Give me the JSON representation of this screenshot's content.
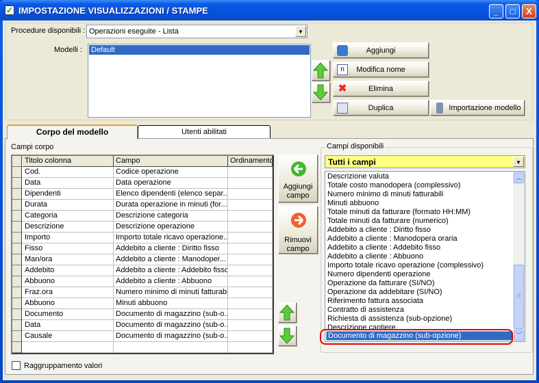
{
  "window": {
    "title": "IMPOSTAZIONE VISUALIZZAZIONI / STAMPE",
    "minimize": "_",
    "maximize": "□",
    "close": "X"
  },
  "top": {
    "procedure_label": "Procedure disponibili :",
    "procedure_value": "Operazioni eseguite - Lista",
    "modelli_label": "Modelli :",
    "modelli": [
      "Default"
    ],
    "buttons": {
      "aggiungi": "Aggiungi",
      "modifica": "Modifica nome",
      "elimina": "Elimina",
      "duplica": "Duplica",
      "importazione": "Importazione modello"
    }
  },
  "tabs": [
    {
      "label": "Corpo del modello",
      "active": true
    },
    {
      "label": "Utenti abilitati",
      "active": false
    }
  ],
  "corpo": {
    "label": "Campi corpo",
    "columns": [
      "Titolo colonna",
      "Campo",
      "Ordinamento"
    ],
    "rows": [
      [
        "Cod.",
        "Codice operazione",
        ""
      ],
      [
        "Data",
        "Data operazione",
        ""
      ],
      [
        "Dipendenti",
        "Elenco dipendenti (elenco separ...",
        ""
      ],
      [
        "Durata",
        "Durata operazione in minuti (for...",
        ""
      ],
      [
        "Categoria",
        "Descrizione categoria",
        ""
      ],
      [
        "Descrizione",
        "Descrizione operazione",
        ""
      ],
      [
        "Importo",
        "Importo totale ricavo operazione...",
        ""
      ],
      [
        "Fisso",
        "Addebito a cliente : Diritto fisso",
        ""
      ],
      [
        "Man/ora",
        "Addebito a cliente : Manodoper...",
        ""
      ],
      [
        "Addebito",
        "Addebito a cliente : Addebito fisso",
        ""
      ],
      [
        "Abbuono",
        "Addebito a cliente : Abbuono",
        ""
      ],
      [
        "Fraz.ora",
        "Numero minimo di minuti fatturabili",
        ""
      ],
      [
        "Abbuono",
        "Minuti abbuono",
        ""
      ],
      [
        "Documento",
        "Documento di magazzino (sub-o...",
        ""
      ],
      [
        "Data",
        "Documento di magazzino (sub-o...",
        ""
      ],
      [
        "Causale",
        "Documento di magazzino (sub-o...",
        ""
      ]
    ],
    "aggiungi_campo": "Aggiungi campo",
    "rimuovi_campo": "Rimuovi campo",
    "raggruppamento": "Raggruppamento valori",
    "raggruppamento_checked": false
  },
  "disponibili": {
    "label": "Campi disponibili",
    "filter": "Tutti i campi",
    "items": [
      "Descrizione valuta",
      "Totale costo manodopera (complessivo)",
      "Numero minimo di minuti fatturabili",
      "Minuti abbuono",
      "Totale minuti da fatturare (formato HH:MM)",
      "Totale minuti da fatturare (numerico)",
      "Addebito a cliente : Diritto fisso",
      "Addebito a cliente : Manodopera oraria",
      "Addebito a cliente : Addebito fisso",
      "Addebito a cliente : Abbuono",
      "Importo totale ricavo operazione (complessivo)",
      "Numero dipendenti operazione",
      "Operazione da fatturare (SI/NO)",
      "Operazione da addebitare (SI/NO)",
      "Riferimento fattura associata",
      "Contratto di assistenza",
      "Richiesta di assistenza (sub-opzione)",
      "Descrizione cantiere"
    ],
    "selected": "Documento di magazzino (sub-opzione)"
  },
  "colors": {
    "selection": "#316ac5",
    "filter_bg": "#ffff80",
    "highlight": "#e00000"
  }
}
